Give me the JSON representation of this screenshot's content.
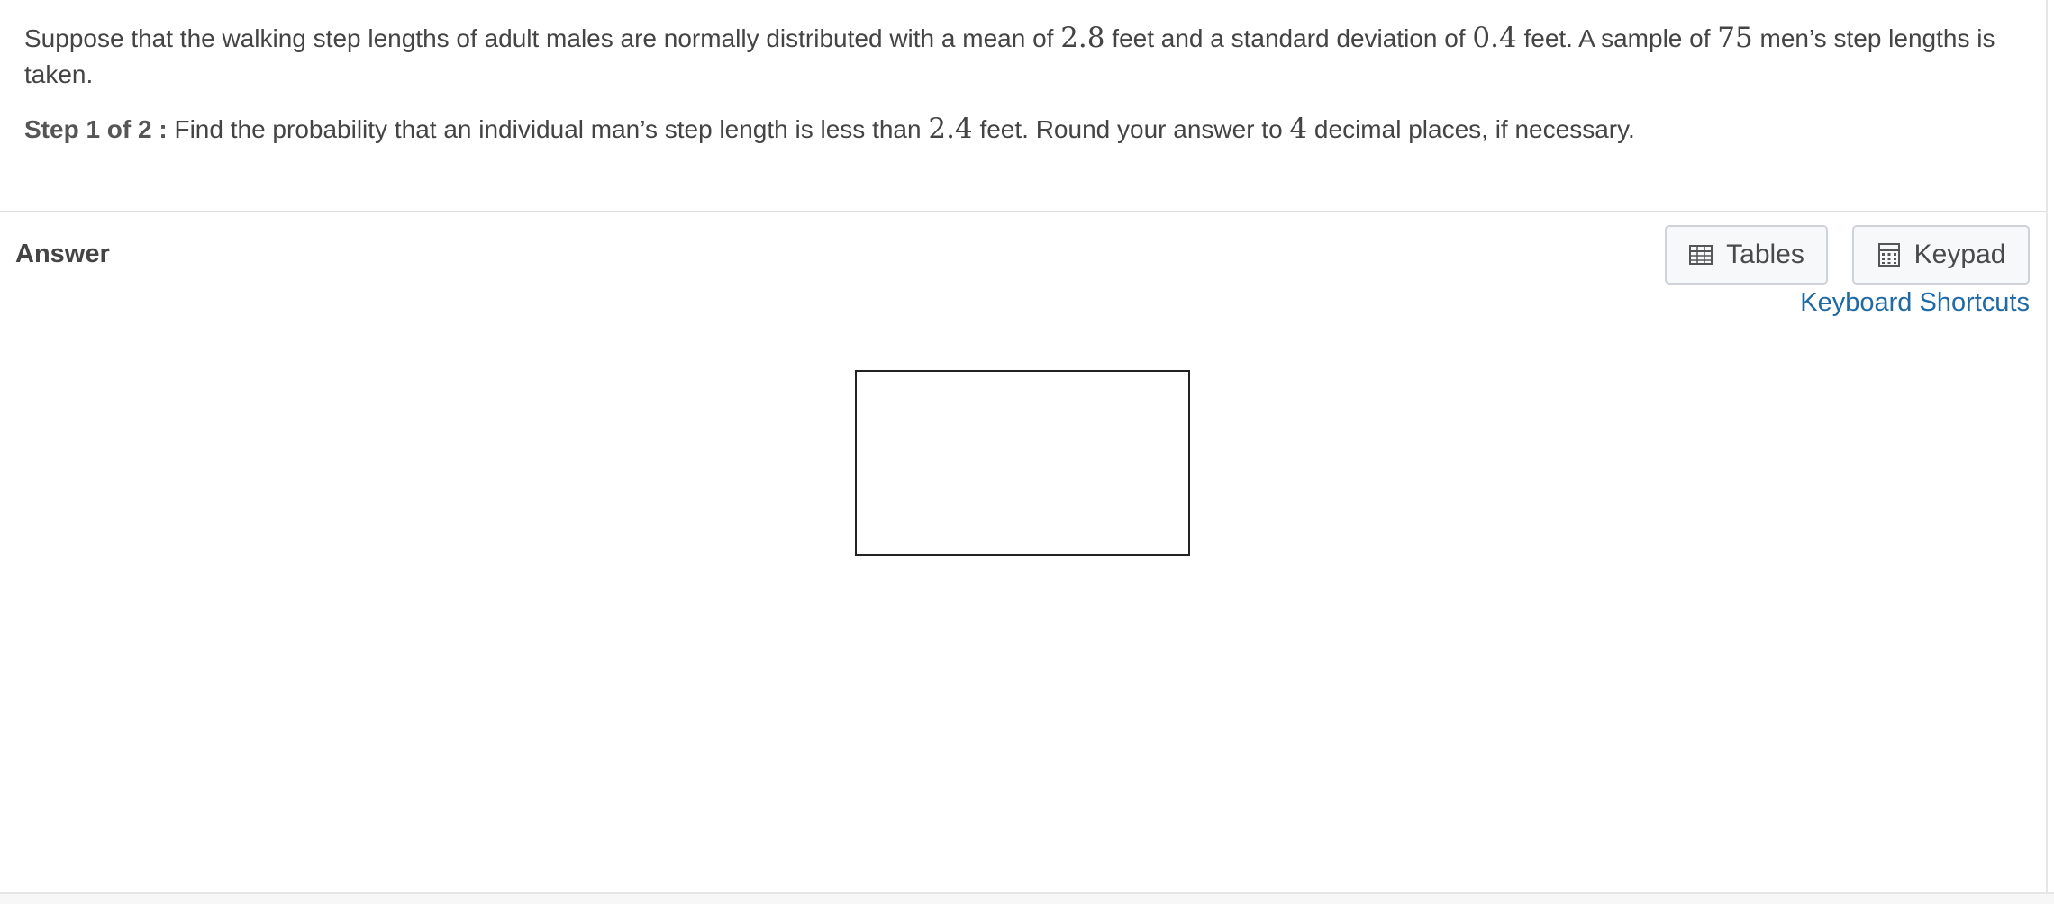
{
  "question": {
    "intro_parts": [
      "Suppose that the walking step lengths of adult males are normally distributed with a mean of ",
      "2.8",
      " feet and a standard deviation of ",
      "0.4",
      " feet. A sample of ",
      "75",
      " men’s step lengths is taken."
    ],
    "step_label": "Step 1 of 2 :",
    "step_parts": [
      " Find the probability that an individual man’s step length is less than ",
      "2.4",
      " feet. Round your answer to ",
      "4",
      " decimal places, if necessary."
    ]
  },
  "answer": {
    "label": "Answer",
    "value": ""
  },
  "toolbar": {
    "tables_label": "Tables",
    "keypad_label": "Keypad",
    "shortcuts_label": "Keyboard Shortcuts"
  },
  "icons": {
    "tables": "table-grid-icon",
    "keypad": "calculator-icon"
  },
  "colors": {
    "text": "#444444",
    "link": "#1f6aa5",
    "button_bg": "#f7f8fa",
    "button_border": "#cfd3d8",
    "answer_border": "#222222"
  }
}
